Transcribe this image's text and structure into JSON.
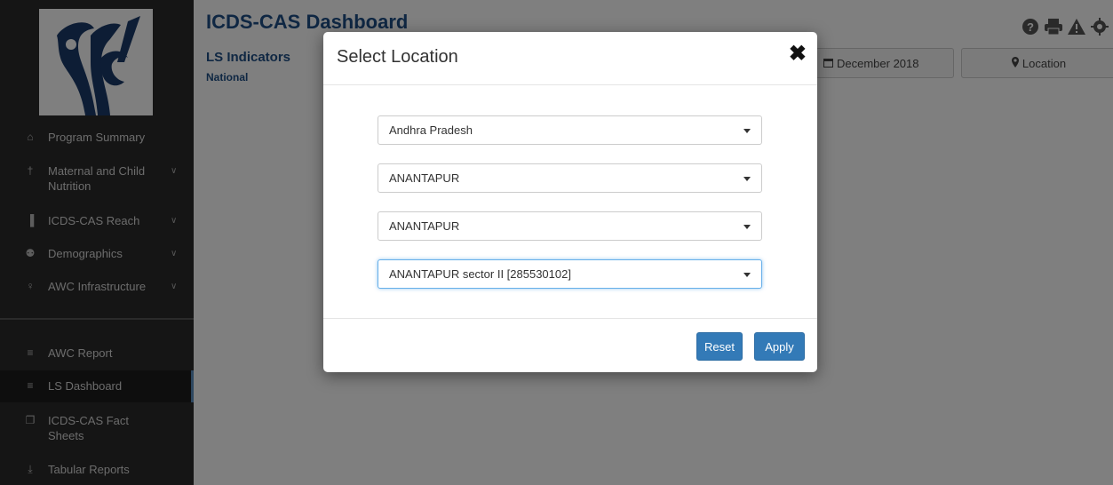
{
  "sidebar": {
    "items": [
      {
        "label": "Program Summary",
        "icon": "home-icon",
        "glyph": "⌂"
      },
      {
        "label": "Maternal and Child Nutrition",
        "icon": "child-icon",
        "glyph": "†",
        "expandable": true
      },
      {
        "label": "ICDS-CAS Reach",
        "icon": "bar-chart-icon",
        "glyph": "▐",
        "expandable": true
      },
      {
        "label": "Demographics",
        "icon": "users-icon",
        "glyph": "⚉",
        "expandable": true
      },
      {
        "label": "AWC Infrastructure",
        "icon": "lightbulb-icon",
        "glyph": "♀",
        "expandable": true
      },
      {
        "label": "AWC Report",
        "icon": "report-icon",
        "glyph": "≡"
      },
      {
        "label": "LS Dashboard",
        "icon": "report-icon",
        "glyph": "≡",
        "active": true
      },
      {
        "label": "ICDS-CAS Fact Sheets",
        "icon": "file-icon",
        "glyph": "❐"
      },
      {
        "label": "Tabular Reports",
        "icon": "download-icon",
        "glyph": "⤓"
      }
    ],
    "chevron": "∨"
  },
  "header": {
    "title": "ICDS-CAS Dashboard",
    "subtitle": "LS Indicators",
    "scope": "National",
    "date_label": "December 2018",
    "date_icon": "calendar-icon",
    "location_label": "Location",
    "location_icon": "map-marker-icon",
    "toolbar_icons": [
      "help-icon",
      "print-icon",
      "warning-icon",
      "gear-icon"
    ]
  },
  "modal": {
    "title": "Select Location",
    "close_glyph": "✖",
    "selects": [
      {
        "value": "Andhra Pradesh"
      },
      {
        "value": "ANANTAPUR"
      },
      {
        "value": "ANANTAPUR"
      },
      {
        "value": "ANANTAPUR sector II [285530102]",
        "focused": true
      }
    ],
    "reset_label": "Reset",
    "apply_label": "Apply"
  },
  "colors": {
    "brand_blue": "#1f4f86",
    "button_blue": "#337ab7",
    "sidebar_bg": "#2a2a2a",
    "active_indicator": "#5a8fc0"
  }
}
